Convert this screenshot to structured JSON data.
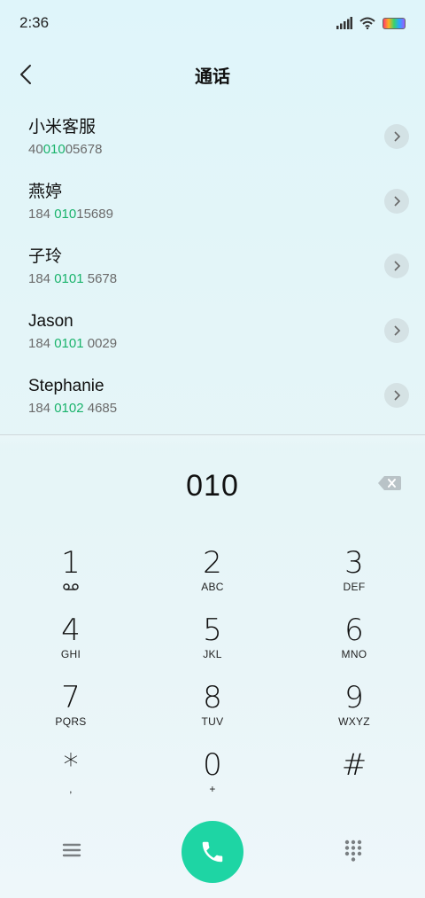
{
  "status": {
    "time": "2:36"
  },
  "header": {
    "title": "通话"
  },
  "contacts": [
    {
      "name": "小米客服",
      "number_pre": "40",
      "number_match": "010",
      "number_post": "05678"
    },
    {
      "name": "燕婷",
      "number_pre": "184 ",
      "number_match": "010",
      "number_post": "15689"
    },
    {
      "name": "子玲",
      "number_pre": "184 ",
      "number_match": "0101",
      "number_post": " 5678"
    },
    {
      "name": "Jason",
      "number_pre": "184 ",
      "number_match": "0101",
      "number_post": " 0029"
    },
    {
      "name": "Stephanie",
      "number_pre": "184 ",
      "number_match": "0102",
      "number_post": " 4685"
    }
  ],
  "dialer": {
    "typed_number": "010"
  },
  "keys": [
    {
      "digit": "1",
      "letters": ""
    },
    {
      "digit": "2",
      "letters": "ABC"
    },
    {
      "digit": "3",
      "letters": "DEF"
    },
    {
      "digit": "4",
      "letters": "GHI"
    },
    {
      "digit": "5",
      "letters": "JKL"
    },
    {
      "digit": "6",
      "letters": "MNO"
    },
    {
      "digit": "7",
      "letters": "PQRS"
    },
    {
      "digit": "8",
      "letters": "TUV"
    },
    {
      "digit": "9",
      "letters": "WXYZ"
    },
    {
      "digit": "*",
      "letters": ","
    },
    {
      "digit": "0",
      "letters": "+"
    },
    {
      "digit": "#",
      "letters": ""
    }
  ],
  "colors": {
    "accent": "#19b36b",
    "call_button": "#1ed5a4"
  },
  "icons": [
    "signal-icon",
    "wifi-icon",
    "battery-icon",
    "back-icon",
    "chevron-right-icon",
    "backspace-icon",
    "voicemail-icon",
    "menu-icon",
    "phone-icon",
    "dialpad-icon"
  ]
}
